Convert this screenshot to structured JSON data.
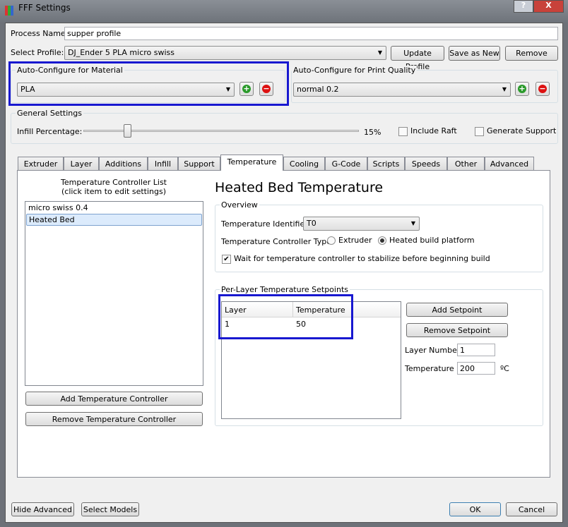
{
  "window": {
    "title": "FFF Settings",
    "help": "?",
    "close": "X"
  },
  "process": {
    "label": "Process Name:",
    "value": "supper profile"
  },
  "profile": {
    "label": "Select Profile:",
    "value": "DJ_Ender 5 PLA micro swiss",
    "update": "Update Profile",
    "save_new": "Save as New",
    "remove": "Remove"
  },
  "material": {
    "title": "Auto-Configure for Material",
    "value": "PLA"
  },
  "quality": {
    "title": "Auto-Configure for Print Quality",
    "value": "normal 0.2"
  },
  "general": {
    "title": "General Settings",
    "infill_label": "Infill Percentage:",
    "infill_value": "15%",
    "infill_fraction": 0.15,
    "raft": "Include Raft",
    "support": "Generate Support"
  },
  "tabs": [
    "Extruder",
    "Layer",
    "Additions",
    "Infill",
    "Support",
    "Temperature",
    "Cooling",
    "G-Code",
    "Scripts",
    "Speeds",
    "Other",
    "Advanced"
  ],
  "active_tab": "Temperature",
  "controllers": {
    "title": "Temperature Controller List",
    "subtitle": "(click item to edit settings)",
    "items": [
      "micro swiss 0.4",
      "Heated Bed"
    ],
    "add": "Add Temperature Controller",
    "remove": "Remove Temperature Controller"
  },
  "detail": {
    "heading": "Heated Bed Temperature",
    "overview": "Overview",
    "identifier_label": "Temperature Identifier",
    "identifier_value": "T0",
    "type_label": "Temperature Controller Type:",
    "type_extruder": "Extruder",
    "type_bed": "Heated build platform",
    "wait_label": "Wait for temperature controller to stabilize before beginning build"
  },
  "setpoints": {
    "title": "Per-Layer Temperature Setpoints",
    "columns": [
      "Layer",
      "Temperature"
    ],
    "rows": [
      [
        "1",
        "50"
      ]
    ],
    "add": "Add Setpoint",
    "remove": "Remove Setpoint",
    "layer_label": "Layer Number",
    "layer_value": "1",
    "temp_label": "Temperature",
    "temp_value": "200",
    "unit": "ºC"
  },
  "footer": {
    "hide_advanced": "Hide Advanced",
    "select_models": "Select Models",
    "ok": "OK",
    "cancel": "Cancel"
  }
}
